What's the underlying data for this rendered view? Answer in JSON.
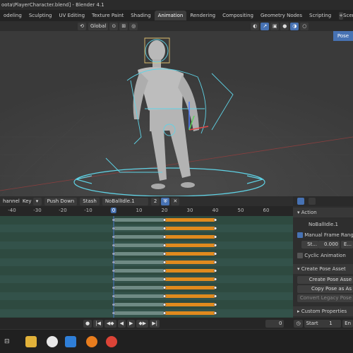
{
  "window": {
    "title": "oota\\PlayerCharacter.blend] - Blender 4.1"
  },
  "workspaces": [
    "odeling",
    "Sculpting",
    "UV Editing",
    "Texture Paint",
    "Shading",
    "Animation",
    "Rendering",
    "Compositing",
    "Geometry Nodes",
    "Scripting"
  ],
  "active_workspace": "Animation",
  "workspace_extra": "Scen",
  "viewport_header": {
    "orientation": "Global",
    "pose_tab": "Pose"
  },
  "dopesheet_header": {
    "channel": "hannel",
    "key": "Key",
    "push_down": "Push Down",
    "stash": "Stash",
    "action_name": "NoBallIdle.1",
    "users": "2"
  },
  "ruler": {
    "ticks": [
      "-40",
      "-30",
      "-20",
      "-10",
      "0",
      "10",
      "20",
      "30",
      "40",
      "50",
      "60"
    ],
    "current_frame": "0"
  },
  "action_panel": {
    "header": "Action",
    "action_name": "NoBallIdle.1",
    "manual_frame_range": "Manual Frame Range",
    "start_label": "St...",
    "start_value": "0.000",
    "end_label": "E...",
    "cyclic_animation": "Cyclic Animation",
    "create_pose_asset_header": "Create Pose Asset",
    "create_pose_asset_button": "Create Pose Asse",
    "copy_pose_button": "Copy Pose as As",
    "convert_legacy_button": "Convert Legacy Pose",
    "custom_properties": "Custom Properties"
  },
  "playback": {
    "current_frame": "0",
    "start_label": "Start",
    "start_value": "1",
    "end_label": "En"
  },
  "colors": {
    "accent_blue": "#4772b3",
    "keyframe_bar": "#e08a1e",
    "track_bg": "#2e4a40",
    "rig_cyan": "#5fd3e6"
  }
}
